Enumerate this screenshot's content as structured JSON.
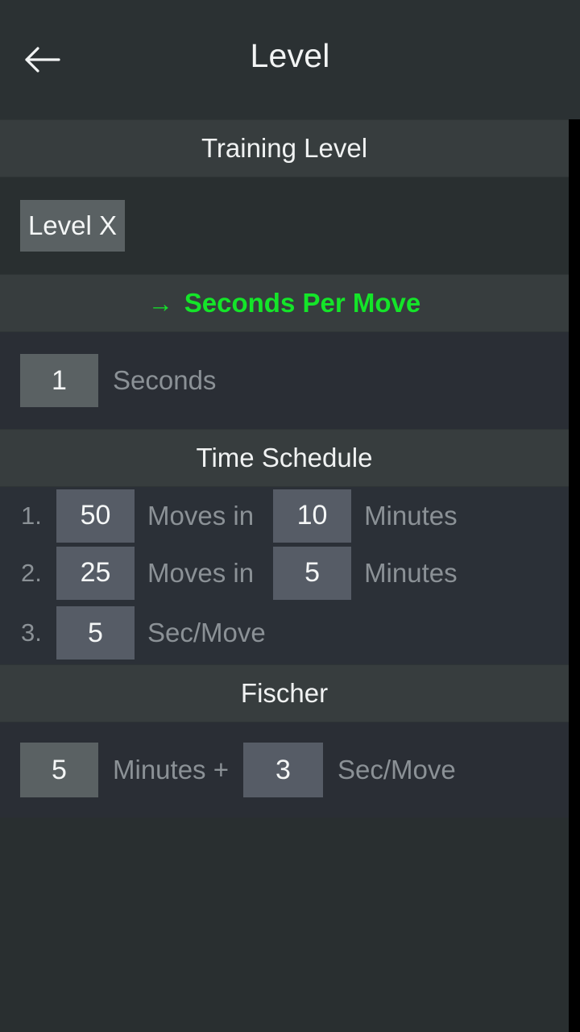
{
  "appbar": {
    "back_icon": "arrow-left-icon",
    "title": "Level"
  },
  "colors": {
    "accent_green": "#14e529",
    "header_band": "#373d3e",
    "page_bg": "#2b3133",
    "field_bg": "#5a6163",
    "muted_text": "#8b9196"
  },
  "sections": {
    "training_level": {
      "header": "Training Level",
      "level_button": "Level X"
    },
    "seconds_per_move": {
      "header": "Seconds Per Move",
      "arrow_glyph": "→",
      "selected": true,
      "value": "1",
      "unit": "Seconds"
    },
    "time_schedule": {
      "header": "Time Schedule",
      "rows": [
        {
          "index": "1.",
          "moves": "50",
          "moves_unit": "Moves in",
          "time": "10",
          "time_unit": "Minutes"
        },
        {
          "index": "2.",
          "moves": "25",
          "moves_unit": "Moves in",
          "time": "5",
          "time_unit": "Minutes"
        },
        {
          "index": "3.",
          "moves": "5",
          "moves_unit": "Sec/Move",
          "time": "",
          "time_unit": ""
        }
      ]
    },
    "fischer": {
      "header": "Fischer",
      "minutes": "5",
      "minutes_unit": "Minutes +",
      "increment": "3",
      "increment_unit": "Sec/Move"
    }
  }
}
